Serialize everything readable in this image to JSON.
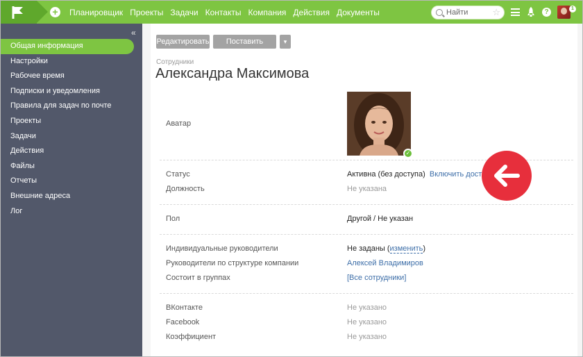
{
  "topbar": {
    "nav": [
      "Планировщик",
      "Проекты",
      "Задачи",
      "Контакты",
      "Компания",
      "Действия",
      "Документы"
    ],
    "search_placeholder": "Найти",
    "notifications_count": "1",
    "colors": {
      "accent": "#7ec542",
      "logo": "#5fa82c"
    },
    "icons": [
      "flag-logo-icon",
      "plus-icon",
      "search-icon",
      "star-icon",
      "menu-icon",
      "rocket-icon",
      "help-icon"
    ]
  },
  "sidebar": {
    "collapse_glyph": "«",
    "items": [
      {
        "label": "Общая информация",
        "active": true
      },
      {
        "label": "Настройки"
      },
      {
        "label": "Рабочее время"
      },
      {
        "label": "Подписки и уведомления"
      },
      {
        "label": "Правила для задач по почте"
      },
      {
        "label": "Проекты"
      },
      {
        "label": "Задачи"
      },
      {
        "label": "Действия"
      },
      {
        "label": "Файлы"
      },
      {
        "label": "Отчеты"
      },
      {
        "label": "Внешние адреса"
      },
      {
        "label": "Лог"
      }
    ]
  },
  "toolbar": {
    "edit_label": "Редактировать",
    "task_label": "Поставить задачу",
    "dropdown_glyph": "▾"
  },
  "breadcrumb": "Сотрудники",
  "title": "Александра Максимова",
  "fields": {
    "avatar_label": "Аватар",
    "status_label": "Статус",
    "status_value": "Активна (без доступа)",
    "status_link": "Включить доступ",
    "position_label": "Должность",
    "position_value": "Не указана",
    "gender_label": "Пол",
    "gender_value": "Другой / Не указан",
    "managers_label": "Индивидуальные руководители",
    "managers_value": "Не заданы",
    "managers_open": "(",
    "managers_link": "изменить",
    "managers_close": ")",
    "structure_label": "Руководители по структуре компании",
    "structure_value": "Алексей Владимиров",
    "groups_label": "Состоит в группах",
    "groups_value": "[Все сотрудники]",
    "vk_label": "ВКонтакте",
    "vk_value": "Не указано",
    "fb_label": "Facebook",
    "fb_value": "Не указано",
    "coef_label": "Коэффициент",
    "coef_value": "Не указано"
  },
  "annotation_color": "#e72f3c"
}
